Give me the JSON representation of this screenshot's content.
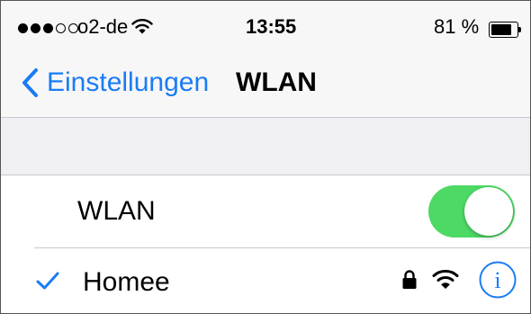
{
  "status_bar": {
    "signal_bars_filled": 3,
    "signal_bars_total": 5,
    "carrier": "o2-de",
    "time": "13:55",
    "battery_percent": "81 %",
    "battery_level": 0.81
  },
  "nav": {
    "back_label": "Einstellungen",
    "title": "WLAN"
  },
  "wlan_toggle": {
    "label": "WLAN",
    "enabled": true
  },
  "networks": [
    {
      "name": "Homee",
      "connected": true,
      "secured": true
    }
  ],
  "colors": {
    "accent": "#1a7cf5",
    "toggle_on": "#4cd964",
    "group_background": "#efeff4"
  }
}
